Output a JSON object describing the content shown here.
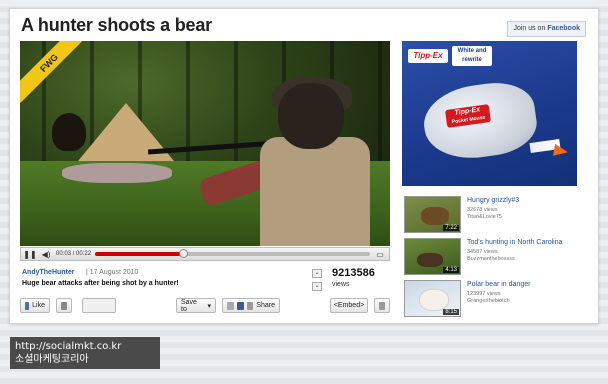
{
  "page": {
    "title": "A hunter  shoots  a bear"
  },
  "header": {
    "fb_join_prefix": "Join us on",
    "fb_join_brand": "Facebook"
  },
  "video": {
    "sash_text": "FWG",
    "current_time": "00:03",
    "separator": "/",
    "total_time": "00:22",
    "progress": 0.32,
    "buffered_progress": 0.32
  },
  "meta": {
    "uploader": "AndyTheHunter",
    "date_sep": "|",
    "date": "17 August 2010",
    "description": "Huge bear attacks after being shot by a hunter!",
    "views_count": "9213586",
    "views_label": "views"
  },
  "actions": {
    "like": "Like",
    "save_to": "Save to",
    "share": "Share",
    "embed": "<Embed>"
  },
  "ad": {
    "brand": "Tipp-Ex",
    "tagline_line1": "White and",
    "tagline_line2": "rewrite",
    "product": "Tipp-Ex",
    "product_sub": "Pocket Mouse",
    "colors": {
      "bg": "#1c3a8e",
      "brand_red": "#d7191f",
      "tip": "#f26a1b"
    }
  },
  "related": [
    {
      "title": "Hungry grizzly#3",
      "views": "32678 views",
      "author": "Titan&Lovie75",
      "duration": "7:22",
      "icon": "bear-thumbnail"
    },
    {
      "title": "Tod's hunting in North Carolina",
      "views": "34587 views",
      "author": "Buzzmanthebossss",
      "duration": "4:13",
      "icon": "hunting-thumbnail"
    },
    {
      "title": "Polar bear in danger",
      "views": "123997 views",
      "author": "Grangerthebiotch",
      "duration": "8:15",
      "icon": "polar-bear-thumbnail"
    }
  ],
  "watermark": {
    "url": "http://socialmkt.co.kr",
    "text": "소셜마케팅코리아"
  }
}
